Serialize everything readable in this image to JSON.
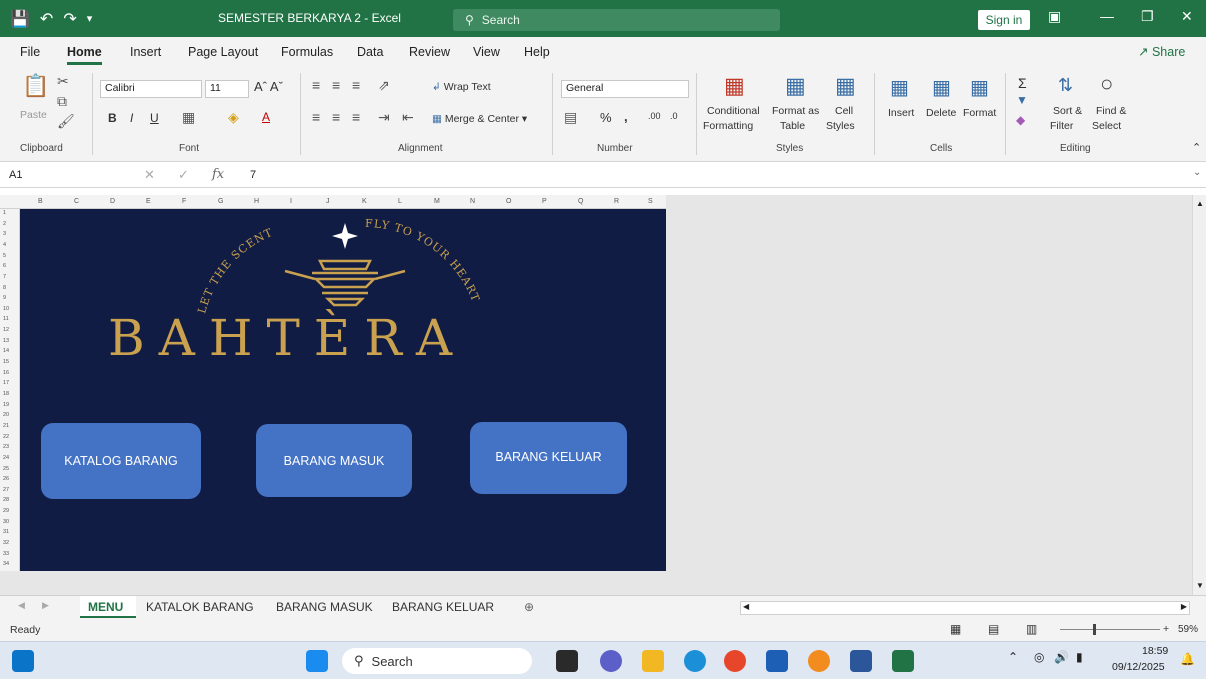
{
  "window": {
    "title": "SEMESTER BERKARYA 2  -  Excel",
    "search_placeholder": "Search",
    "sign_in": "Sign in"
  },
  "ribbon_tabs": [
    "File",
    "Home",
    "Insert",
    "Page Layout",
    "Formulas",
    "Data",
    "Review",
    "View",
    "Help"
  ],
  "share_label": "Share",
  "ribbon": {
    "clipboard": {
      "paste": "Paste",
      "label": "Clipboard"
    },
    "font": {
      "name": "Calibri",
      "size": "11",
      "label": "Font"
    },
    "alignment": {
      "wrap": "Wrap Text",
      "merge": "Merge & Center",
      "label": "Alignment"
    },
    "number": {
      "format": "General",
      "label": "Number"
    },
    "styles": {
      "conditional_1": "Conditional",
      "conditional_2": "Formatting",
      "format_as_1": "Format as",
      "format_as_2": "Table",
      "cell_1": "Cell",
      "cell_2": "Styles",
      "label": "Styles"
    },
    "cells": {
      "insert": "Insert",
      "delete": "Delete",
      "format": "Format",
      "label": "Cells"
    },
    "editing": {
      "sort_1": "Sort &",
      "sort_2": "Filter",
      "find_1": "Find &",
      "find_2": "Select",
      "label": "Editing"
    }
  },
  "formula_bar": {
    "cell_ref": "A1",
    "value": "7"
  },
  "columns": [
    "B",
    "C",
    "D",
    "E",
    "F",
    "G",
    "H",
    "I",
    "J",
    "K",
    "L",
    "M",
    "N",
    "O",
    "P",
    "Q",
    "R",
    "S"
  ],
  "rows": [
    "1",
    "2",
    "3",
    "4",
    "5",
    "6",
    "7",
    "8",
    "9",
    "10",
    "11",
    "12",
    "13",
    "14",
    "15",
    "16",
    "17",
    "18",
    "19",
    "20",
    "21",
    "22",
    "23",
    "24",
    "25",
    "26",
    "27",
    "28",
    "29",
    "30",
    "31",
    "32",
    "33",
    "34"
  ],
  "logo": {
    "arc_left": "LET THE SCENT",
    "arc_right": "FLY TO YOUR HEART",
    "brand": "BAHTÈRA"
  },
  "menu_buttons": [
    "KATALOG BARANG",
    "BARANG MASUK",
    "BARANG KELUAR"
  ],
  "sheet_tabs": [
    "MENU",
    "KATALOK BARANG",
    "BARANG MASUK",
    "BARANG KELUAR"
  ],
  "status": {
    "ready": "Ready",
    "zoom": "59%"
  },
  "taskbar": {
    "search": "Search",
    "time": "18:59",
    "date": "09/12/2025"
  },
  "colors": {
    "excel_green": "#217346",
    "canvas_navy": "#101c44",
    "button_blue": "#4472c4",
    "gold": "#c9a14f"
  }
}
